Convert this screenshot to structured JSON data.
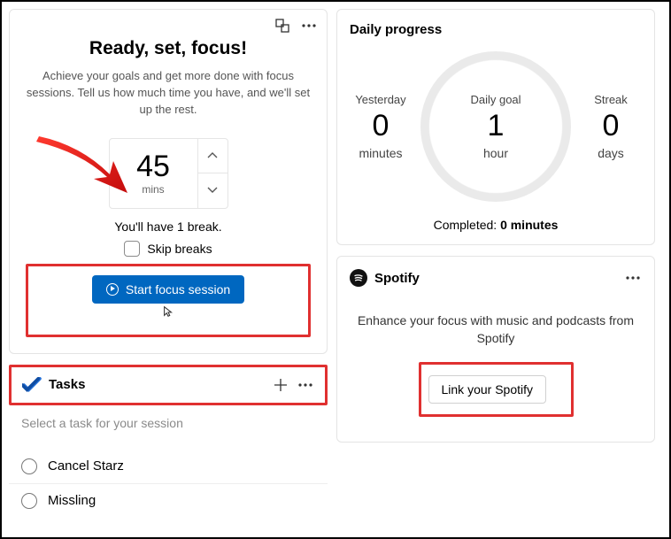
{
  "focus": {
    "title": "Ready, set, focus!",
    "subtitle": "Achieve your goals and get more done with focus sessions. Tell us how much time you have, and we'll set up the rest.",
    "time_value": "45",
    "time_unit": "mins",
    "break_text": "You'll have 1 break.",
    "skip_label": "Skip breaks",
    "start_label": "Start focus session"
  },
  "tasks": {
    "title": "Tasks",
    "hint": "Select a task for your session",
    "items": [
      "Cancel Starz",
      "Missling"
    ]
  },
  "progress": {
    "title": "Daily progress",
    "yesterday_label": "Yesterday",
    "yesterday_value": "0",
    "yesterday_unit": "minutes",
    "goal_label": "Daily goal",
    "goal_value": "1",
    "goal_unit": "hour",
    "streak_label": "Streak",
    "streak_value": "0",
    "streak_unit": "days",
    "completed_prefix": "Completed: ",
    "completed_value": "0 minutes"
  },
  "spotify": {
    "brand": "Spotify",
    "body": "Enhance your focus with music and podcasts from Spotify",
    "link_label": "Link your Spotify"
  }
}
